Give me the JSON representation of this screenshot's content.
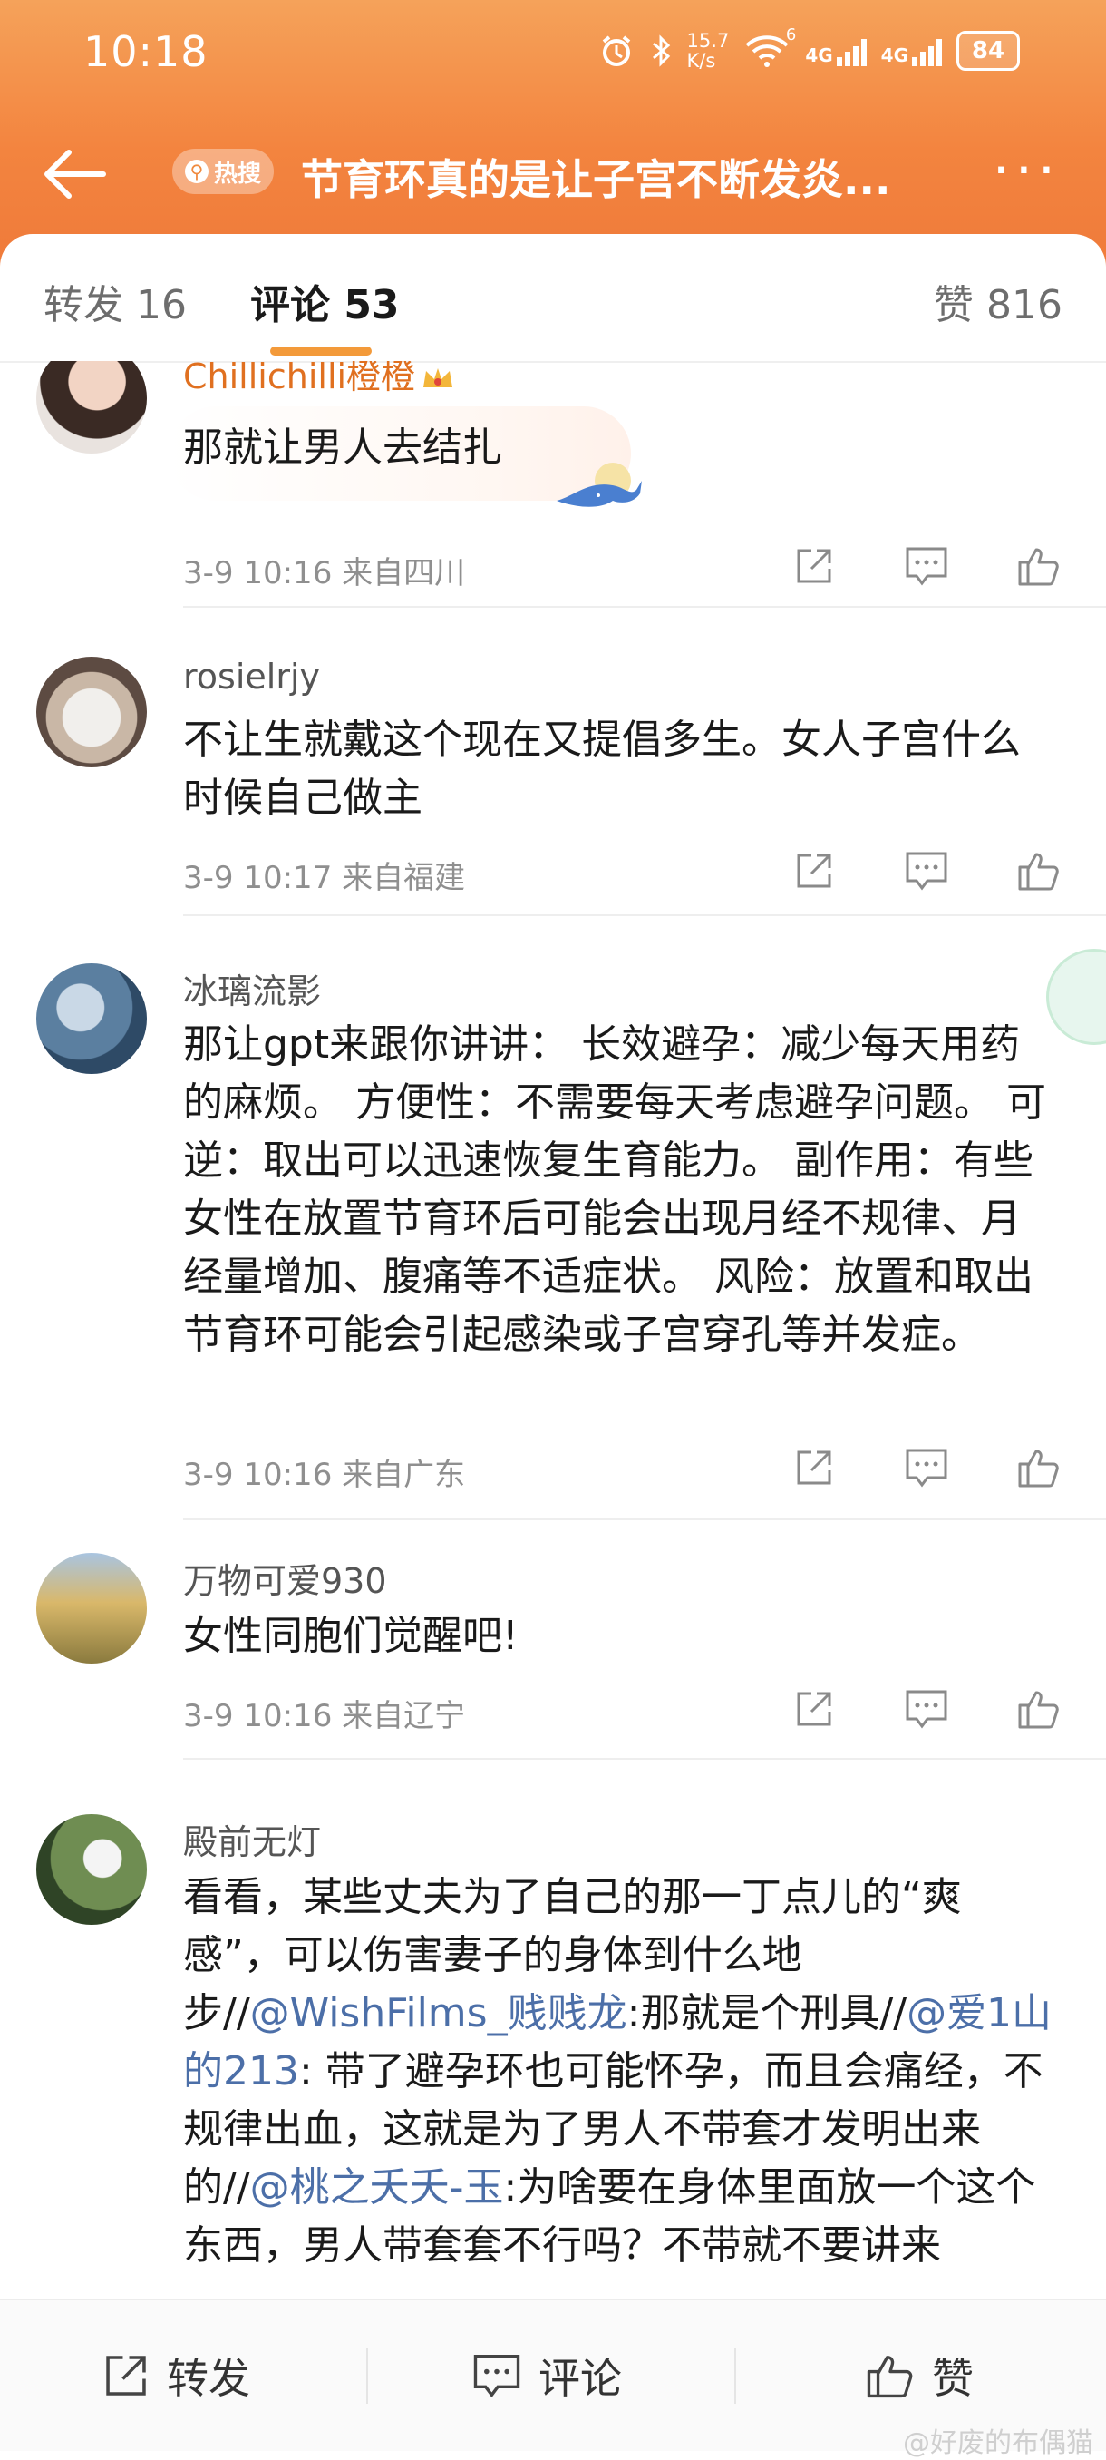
{
  "status_bar": {
    "time": "10:18",
    "network_speed_top": "15.7",
    "network_speed_unit": "K/s",
    "wifi_badge": "6",
    "sim1": "4G",
    "sim2": "4G",
    "battery": "84"
  },
  "nav": {
    "hot_tag": "热搜",
    "title": "节育环真的是让子宫不断发炎..."
  },
  "tabs": {
    "repost": "转发 16",
    "comments": "评论 53",
    "likes": "赞 816"
  },
  "comments": [
    {
      "user": "Chillichilli橙橙",
      "text": "那就让男人去结扎",
      "meta": "3-9 10:16 来自四川"
    },
    {
      "user": "rosielrjy",
      "text": "不让生就戴这个现在又提倡多生。女人子宫什么时候自己做主",
      "meta": "3-9 10:17 来自福建"
    },
    {
      "user": "冰璃流影",
      "text": "那让gpt来跟你讲讲： 长效避孕：减少每天用药的麻烦。 方便性：不需要每天考虑避孕问题。 可逆：取出可以迅速恢复生育能力。 副作用：有些女性在放置节育环后可能会出现月经不规律、月经量增加、腹痛等不适症状。 风险：放置和取出节育环可能会引起感染或子宫穿孔等并发症。",
      "meta": "3-9 10:16 来自广东"
    },
    {
      "user": "万物可爱930",
      "text": "女性同胞们觉醒吧!",
      "meta": "3-9 10:16 来自辽宁"
    },
    {
      "user": "殿前无灯",
      "text_part1": "看看，某些丈夫为了自己的那一丁点儿的“爽感”，可以伤害妻子的身体到什么地步//",
      "mention1": "@WishFilms_贱贱龙",
      "text_part2": ":那就是个刑具//",
      "mention2": "@爱1山的213",
      "text_part3": ": 带了避孕环也可能怀孕，而且会痛经，不规律出血，这就是为了男人不带套才发明出来的//",
      "mention3": "@桃之夭夭-玉",
      "text_part4": ":为啥要在身体里面放一个这个东西，男人带套套不行吗？不带就不要讲来"
    }
  ],
  "bottom_bar": {
    "repost": "转发",
    "comment": "评论",
    "like": "赞"
  },
  "watermark": "@好废的布偶猫",
  "colors": {
    "header_orange": "#f3843f",
    "accent_underline": "#f39a3a",
    "mention_blue": "#4c6fa8",
    "vip_name": "#e07020"
  }
}
